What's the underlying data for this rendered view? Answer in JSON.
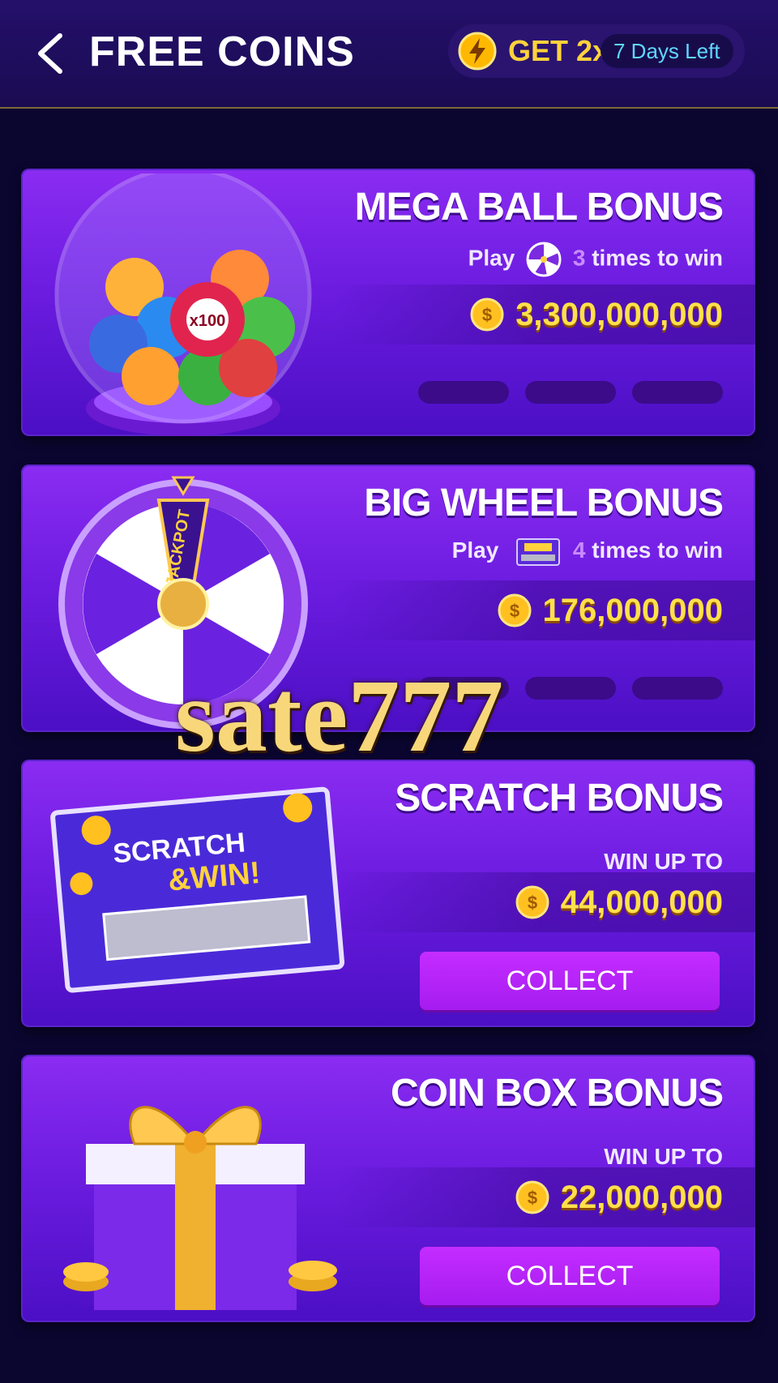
{
  "header": {
    "title": "FREE COINS",
    "boost_label": "GET 2x",
    "days_left": "7 Days Left"
  },
  "cards": [
    {
      "title": "MEGA BALL BONUS",
      "sub_prefix": "Play",
      "sub_icon": "wheel-icon",
      "sub_count": "3",
      "sub_suffix": "times to win",
      "amount": "3,300,000,000",
      "progress_filled": 0,
      "progress_total": 3
    },
    {
      "title": "BIG WHEEL BONUS",
      "sub_prefix": "Play",
      "sub_icon": "scratch-card-icon",
      "sub_count": "4",
      "sub_suffix": "times to win",
      "amount": "176,000,000",
      "progress_filled": 0,
      "progress_total": 3
    },
    {
      "title": "SCRATCH BONUS",
      "win_label": "WIN UP TO",
      "amount": "44,000,000",
      "button": "COLLECT"
    },
    {
      "title": "COIN BOX BONUS",
      "win_label": "WIN UP TO",
      "amount": "22,000,000",
      "button": "COLLECT"
    }
  ],
  "artwork": {
    "scratch_card_text_1": "SCRATCH",
    "scratch_card_text_2": "&WIN!",
    "jackpot_text": "JACKPOT"
  },
  "watermark": "sate777",
  "colors": {
    "background": "#0b0630",
    "card": "#7a22ea",
    "coin_gold": "#ffd23c",
    "days_text": "#5fd8ff",
    "collect_button": "#b624f8"
  }
}
